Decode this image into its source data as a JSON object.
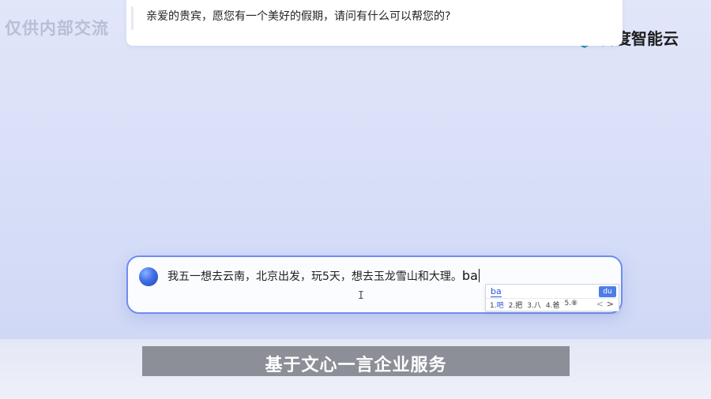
{
  "watermark": "仅供内部交流",
  "brand": {
    "name": "百度智能云",
    "logo_icon": "baidu-cloud-cube-icon",
    "colors": [
      "#2f6ce0",
      "#27b46e",
      "#e0372f",
      "#f5a623"
    ]
  },
  "chat": {
    "assistant_message": "亲爱的贵宾，愿您有一个美好的假期，请问有什么可以帮您的?"
  },
  "input": {
    "avatar_icon": "assistant-orb-icon",
    "text": "我五一想去云南，北京出发，玩5天，想去玉龙雪山和大理。",
    "composing": "ba",
    "cursor_icon": "ibeam-cursor-icon"
  },
  "ime": {
    "pinyin": "ba",
    "badge": "du",
    "candidates": [
      {
        "num": "1.",
        "char": "吧"
      },
      {
        "num": "2.",
        "char": "把"
      },
      {
        "num": "3.",
        "char": "八"
      },
      {
        "num": "4.",
        "char": "爸"
      },
      {
        "num": "5.",
        "char": "⑧"
      }
    ],
    "prev": "<",
    "next": ">"
  },
  "subtitle": "基于文心一言企业服务"
}
